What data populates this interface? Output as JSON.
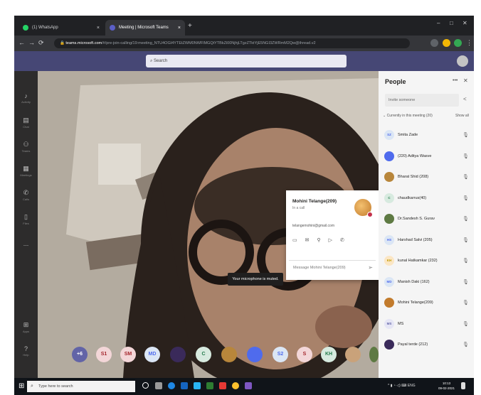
{
  "browser": {
    "tabs": [
      {
        "label": "(1) WhatsApp",
        "active": false
      },
      {
        "label": "Meeting | Microsoft Teams",
        "active": true
      }
    ],
    "url_host": "teams.microsoft.com",
    "url_path": "/#/pre-join-calling/19:meeting_NTU4OGI4YTEtZWM0NWFlMGQtYTBkZi00NjhjLTgzZTktYjE5NGI3ZWRmM2Qw@thread.v2"
  },
  "teams": {
    "search_placeholder": "Search",
    "user_initials": "U"
  },
  "rail": [
    {
      "icon": "bell-icon",
      "label": "Activity"
    },
    {
      "icon": "chat-icon",
      "label": "Chat"
    },
    {
      "icon": "teams-icon",
      "label": "Teams"
    },
    {
      "icon": "calendar-icon",
      "label": "Meetings"
    },
    {
      "icon": "phone-icon",
      "label": "Calls"
    },
    {
      "icon": "file-icon",
      "label": "Files"
    },
    {
      "icon": "more-icon",
      "label": "..."
    }
  ],
  "rail_bottom": [
    {
      "icon": "apps-icon",
      "label": "Apps"
    },
    {
      "icon": "help-icon",
      "label": "Help"
    }
  ],
  "strip": [
    {
      "text": "+6",
      "bg": "#6264a7",
      "fg": "#ffffff"
    },
    {
      "text": "S1",
      "bg": "#f3d6d8",
      "fg": "#a4262c"
    },
    {
      "text": "SM",
      "bg": "#f3d6d8",
      "fg": "#a4262c"
    },
    {
      "text": "MD",
      "bg": "#dbe6f5",
      "fg": "#4f6bed"
    },
    {
      "text": "",
      "bg": "#3a2a5a",
      "fg": "#ffffff"
    },
    {
      "text": "C",
      "bg": "#d7eadf",
      "fg": "#237b4b"
    },
    {
      "text": "",
      "bg": "#b8863b",
      "fg": "#ffffff"
    },
    {
      "text": "",
      "bg": "#4f6bed",
      "fg": "#ffffff"
    },
    {
      "text": "S2",
      "bg": "#dbe6f5",
      "fg": "#4f6bed"
    },
    {
      "text": "S",
      "bg": "#f3d6d8",
      "fg": "#a4262c"
    },
    {
      "text": "KH",
      "bg": "#d7eadf",
      "fg": "#237b4b"
    },
    {
      "text": "",
      "bg": "#c9a27a",
      "fg": "#ffffff"
    },
    {
      "text": "",
      "bg": "#5e7a43",
      "fg": "#ffffff"
    }
  ],
  "toast": "Your microphone is muted.",
  "card": {
    "name": "Mohini Telange(209)",
    "status": "In a call",
    "email": "telangemohini@gmail.com",
    "message_placeholder": "Message Mohini Telange(209)"
  },
  "people": {
    "title": "People",
    "invite_placeholder": "Invite someone",
    "in_meeting": "Currently in this meeting (20)",
    "show_all": "Show all",
    "list": [
      {
        "initials": "SZ",
        "name": "Smita Zade",
        "bg": "#dbe6f5",
        "fg": "#4f6bed"
      },
      {
        "initials": "",
        "name": "(220) Aditya Wasve",
        "bg": "#4f6bed",
        "fg": "#ffffff"
      },
      {
        "initials": "",
        "name": "Bharat Shid (208)",
        "bg": "#b8863b",
        "fg": "#ffffff"
      },
      {
        "initials": "C",
        "name": "chaudkarrus(40)",
        "bg": "#d7eadf",
        "fg": "#237b4b"
      },
      {
        "initials": "",
        "name": "Dr.Sandesh S. Gurav",
        "bg": "#5e7a43",
        "fg": "#ffffff"
      },
      {
        "initials": "HS",
        "name": "Harshad Salvi (205)",
        "bg": "#dbe6f5",
        "fg": "#4f6bed"
      },
      {
        "initials": "KH",
        "name": "kunal Hatkamkar (232)",
        "bg": "#fbe6c4",
        "fg": "#c19c00"
      },
      {
        "initials": "MD",
        "name": "Manish Daki (162)",
        "bg": "#dbe6f5",
        "fg": "#4f6bed"
      },
      {
        "initials": "",
        "name": "Mohini Telange(209)",
        "bg": "#c27b2c",
        "fg": "#ffffff"
      },
      {
        "initials": "MS",
        "name": "MS",
        "bg": "#e6e6f5",
        "fg": "#6264a7"
      },
      {
        "initials": "",
        "name": "Payal terde (212)",
        "bg": "#3a2a5a",
        "fg": "#ffffff"
      }
    ]
  },
  "taskbar": {
    "search_placeholder": "Type here to search",
    "time": "10:13",
    "date": "09-02-2021",
    "lang": "ENG"
  }
}
